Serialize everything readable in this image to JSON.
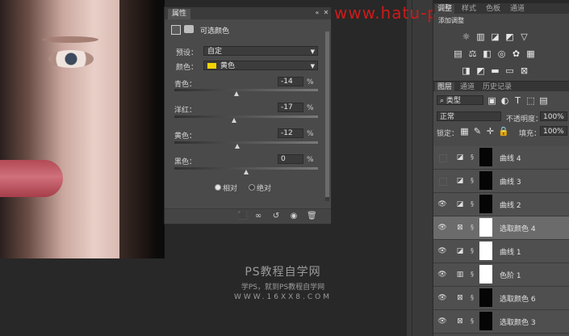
{
  "watermark": "www.hatu-photo.com",
  "credit": {
    "line1": "PS教程自学网",
    "line2": "学PS，就到PS教程自学网",
    "line3": "WWW.16XX8.COM"
  },
  "properties": {
    "tab": "属性",
    "title": "可选颜色",
    "preset_label": "预设：",
    "preset_value": "自定",
    "color_label": "颜色：",
    "color_value": "黄色",
    "color_swatch": "#f2d400",
    "sliders": [
      {
        "label": "青色：",
        "value": "-14",
        "unit": "%",
        "level": -14
      },
      {
        "label": "洋红：",
        "value": "-17",
        "unit": "%",
        "level": -17
      },
      {
        "label": "黄色：",
        "value": "-12",
        "unit": "%",
        "level": -12
      },
      {
        "label": "黑色：",
        "value": "0",
        "unit": "%",
        "level": 0
      }
    ],
    "mode_relative": "相对",
    "mode_absolute": "绝对",
    "selected_mode": "relative"
  },
  "adjustments": {
    "tabs": [
      "调整",
      "样式",
      "色板",
      "通道"
    ],
    "icons": [
      "brightness-icon",
      "levels-icon",
      "curves-icon",
      "exposure-icon",
      "vibrance-icon",
      "hue-saturation-icon",
      "color-balance-icon",
      "black-white-icon",
      "photo-filter-icon",
      "channel-mixer-icon",
      "color-lookup-icon",
      "invert-icon",
      "posterize-icon",
      "threshold-icon",
      "gradient-map-icon",
      "selective-color-icon"
    ]
  },
  "layers": {
    "tabs": [
      "图层",
      "通道",
      "历史记录"
    ],
    "filter": "类型",
    "blend_mode": "正常",
    "opacity_label": "不透明度：",
    "opacity_value": "100%",
    "lock_label": "锁定：",
    "fill_label": "填充：",
    "fill_value": "100%",
    "rows": [
      {
        "name": "曲线 4",
        "visible": false,
        "type": "curves",
        "mask": "dark",
        "selected": false
      },
      {
        "name": "曲线 3",
        "visible": false,
        "type": "curves",
        "mask": "dark",
        "selected": false
      },
      {
        "name": "曲线 2",
        "visible": true,
        "type": "curves",
        "mask": "dark",
        "selected": false
      },
      {
        "name": "选取颜色 4",
        "visible": true,
        "type": "selective-color",
        "mask": "white",
        "selected": true
      },
      {
        "name": "曲线 1",
        "visible": true,
        "type": "curves",
        "mask": "white",
        "selected": false
      },
      {
        "name": "色阶 1",
        "visible": true,
        "type": "levels",
        "mask": "white",
        "selected": false
      },
      {
        "name": "选取颜色 6",
        "visible": true,
        "type": "selective-color",
        "mask": "dark",
        "selected": false
      },
      {
        "name": "选取颜色 3",
        "visible": true,
        "type": "selective-color",
        "mask": "dark",
        "selected": false
      }
    ]
  }
}
